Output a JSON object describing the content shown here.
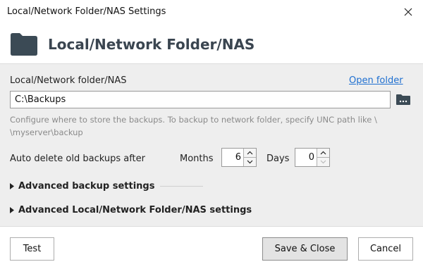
{
  "window": {
    "title": "Local/Network Folder/NAS Settings"
  },
  "header": {
    "title": "Local/Network Folder/NAS"
  },
  "folder": {
    "label": "Local/Network folder/NAS",
    "open_folder_link": "Open folder",
    "path_value": "C:\\Backups",
    "hint_line1": "Configure where to store the backups. To backup to network folder, specify UNC path like \\",
    "hint_line2": "\\myserver\\backup"
  },
  "auto_delete": {
    "label": "Auto delete old backups after",
    "months_label": "Months",
    "months_value": "6",
    "days_label": "Days",
    "days_value": "0"
  },
  "sections": [
    {
      "label": "Advanced backup settings"
    },
    {
      "label": "Advanced Local/Network Folder/NAS settings"
    }
  ],
  "footer": {
    "test_label": "Test",
    "save_close_label": "Save & Close",
    "cancel_label": "Cancel"
  },
  "colors": {
    "link": "#1e6fd0",
    "header_text": "#3a4550",
    "content_bg": "#eeeeee"
  },
  "icons": {
    "header": "folder-icon",
    "browse": "folder-browse-icon",
    "close": "close-icon"
  }
}
